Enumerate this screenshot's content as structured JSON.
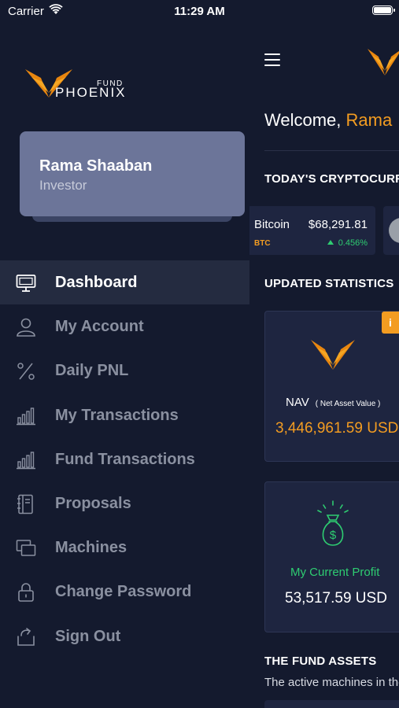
{
  "status_bar": {
    "carrier": "Carrier",
    "time": "11:29 AM"
  },
  "brand": {
    "fund": "FUND",
    "name": "PHOENIX",
    "accent": "#f39c21"
  },
  "profile": {
    "name": "Rama Shaaban",
    "role": "Investor"
  },
  "menu": [
    {
      "label": "Dashboard",
      "icon": "monitor-icon",
      "active": true
    },
    {
      "label": "My Account",
      "icon": "user-icon",
      "active": false
    },
    {
      "label": "Daily PNL",
      "icon": "percent-icon",
      "active": false
    },
    {
      "label": "My Transactions",
      "icon": "bar-chart-icon",
      "active": false
    },
    {
      "label": "Fund Transactions",
      "icon": "bar-chart-icon",
      "active": false
    },
    {
      "label": "Proposals",
      "icon": "notebook-icon",
      "active": false
    },
    {
      "label": "Machines",
      "icon": "machines-icon",
      "active": false
    },
    {
      "label": "Change Password",
      "icon": "lock-icon",
      "active": false
    },
    {
      "label": "Sign Out",
      "icon": "sign-out-icon",
      "active": false
    }
  ],
  "main": {
    "welcome": "Welcome,",
    "user": "Rama",
    "crypto_section": "TODAY'S CRYPTOCURRENCIES",
    "crypto": [
      {
        "name": "Bitcoin",
        "symbol": "BTC",
        "price": "$68,291.81",
        "change": "0.456%"
      }
    ],
    "stats_section": "UPDATED STATISTICS",
    "info_badge": "i",
    "nav": {
      "label": "NAV",
      "sublabel": "( Net Asset Value )",
      "value": "3,446,961.59 USD"
    },
    "profit": {
      "label": "My Current Profit",
      "value": "53,517.59 USD"
    },
    "assets_section": "THE FUND ASSETS",
    "assets_desc": "The active machines in the fund"
  }
}
